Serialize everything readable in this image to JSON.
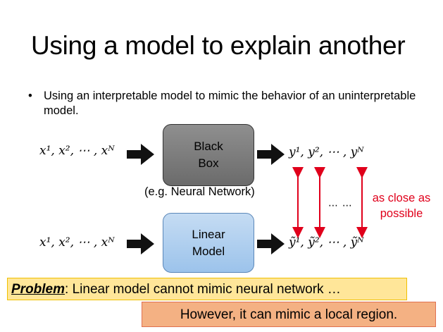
{
  "slide": {
    "title": "Using a model to explain another",
    "bullet_symbol": "•",
    "bullet": "Using an interpretable model to mimic the behavior of an uninterpretable model."
  },
  "diagram": {
    "input_top": "x¹, x², ⋯ , xᴺ",
    "input_bottom": "x¹, x², ⋯ , xᴺ",
    "black_box_line1": "Black",
    "black_box_line2": "Box",
    "example_note": "(e.g. Neural Network)",
    "linear_line1": "Linear",
    "linear_line2": "Model",
    "output_top": "y¹, y², ⋯ , yᴺ",
    "output_bottom": "ỹ¹, ỹ², ⋯ , ỹᴺ",
    "ellipsis": "⋯ ⋯",
    "close_line1": "as close as",
    "close_line2": "possible"
  },
  "callouts": {
    "problem_label": "Problem",
    "problem_text": ": Linear model cannot mimic neural network …",
    "however_text": "However, it can mimic a local region."
  },
  "colors": {
    "accent_red": "#e0001b",
    "black_box": "#7a7a7a",
    "linear_box": "#b4d1ef",
    "problem_bg": "#ffe699",
    "however_bg": "#f4b183"
  },
  "icons": [
    "right-arrow-icon",
    "double-arrow-icon"
  ]
}
